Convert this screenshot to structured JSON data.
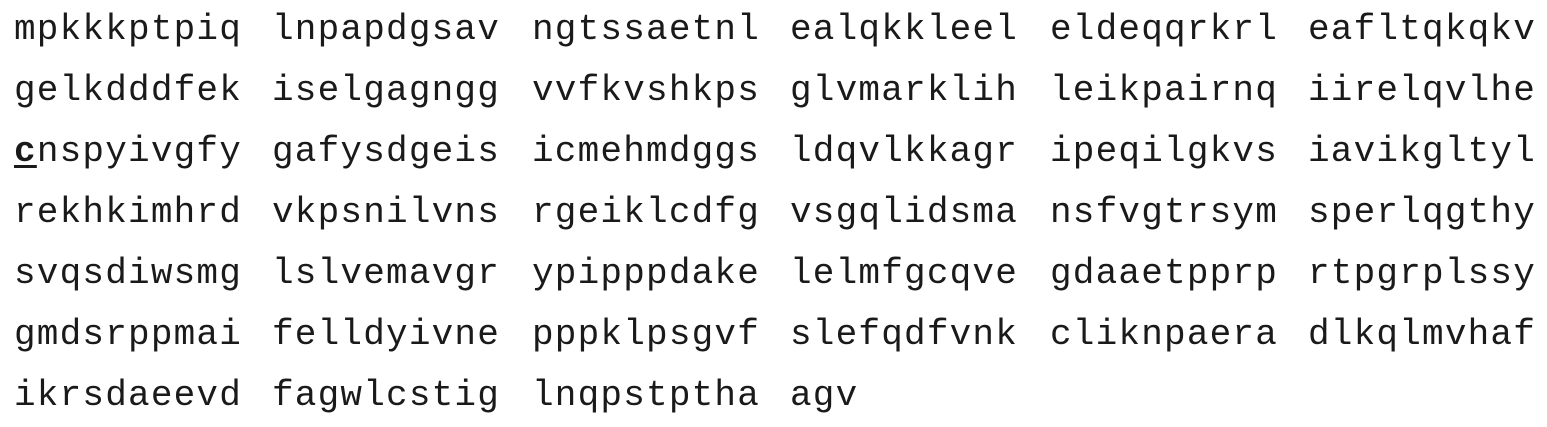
{
  "sequence": {
    "rows": [
      [
        "mpkkkptpiq",
        "lnpapdgsav",
        "ngtssaetnl",
        "ealqkkleel",
        "eldeqqrkrl",
        "eafltqkqkv"
      ],
      [
        "gelkdddfek",
        "iselgagngg",
        "vvfkvshkps",
        "glvmarklih",
        "leikpairnq",
        "iirelqvlhe"
      ],
      [
        "cnspyivgfy",
        "gafysdgeis",
        "icmehmdggs",
        "ldqvlkkagr",
        "ipeqilgkvs",
        "iavikgltyl"
      ],
      [
        "rekhkimhrd",
        "vkpsnilvns",
        "rgeiklcdfg",
        "vsgqlidsma",
        "nsfvgtrsym",
        "sperlqgthy"
      ],
      [
        "svqsdiwsmg",
        "lslvemavgr",
        "ypipppdake",
        "lelmfgcqve",
        "gdaaetpprp",
        "rtpgrplssy"
      ],
      [
        "gmdsrppmai",
        "felldyivne",
        "pppklpsgvf",
        "slefqdfvnk",
        "cliknpaera",
        "dlkqlmvhaf"
      ],
      [
        "ikrsdaeevd",
        "fagwlcstig",
        "lnqpstptha",
        "agv"
      ]
    ],
    "row3_first_char": "c",
    "row3_first_rest": "nspyivgfy"
  }
}
